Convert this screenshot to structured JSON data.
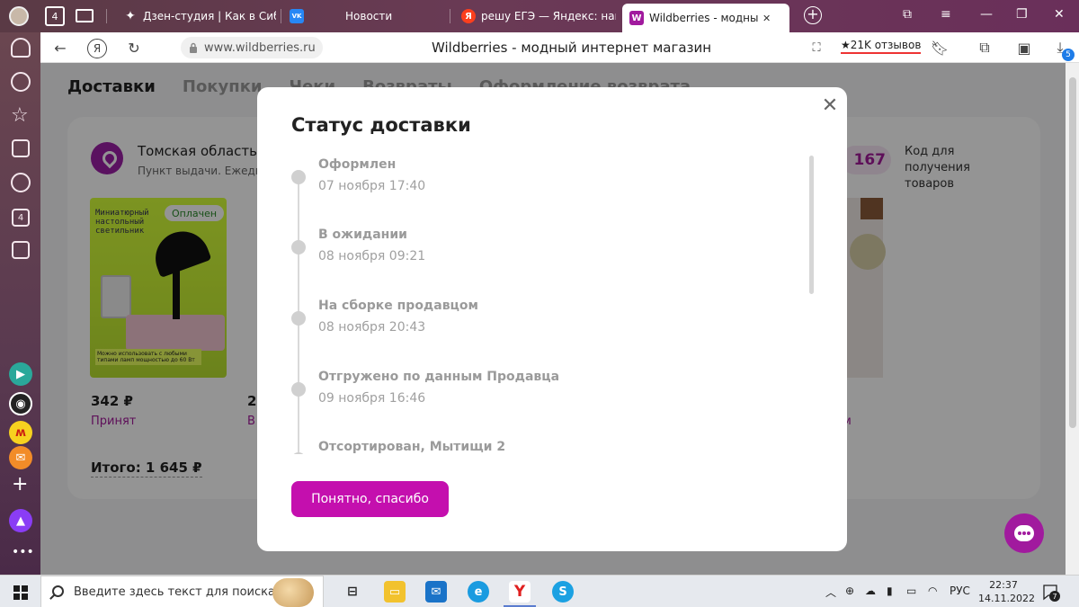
{
  "browser": {
    "tab_count": "4",
    "tabs": [
      {
        "label": "Дзен-студия | Как в Сибир"
      },
      {
        "label": "Новости"
      },
      {
        "label": "решу ЕГЭ — Яндекс: нашл"
      },
      {
        "label": "Wildberries - модный ин"
      }
    ],
    "vk_label": "VK",
    "url": "www.wildberries.ru",
    "page_title": "Wildberries - модный интернет магазин",
    "reviews": "★21K отзывов",
    "downloads_badge": "5",
    "sidebar_badge": "4"
  },
  "page": {
    "nav_tabs": [
      "Доставки",
      "Покупки",
      "Чеки",
      "Возвраты",
      "Оформление возврата"
    ],
    "address_line1": "Томская область, То",
    "address_line2": "Пункт выдачи. Ежедне",
    "pickup_code": "167",
    "code_label": "Код для получения товаров",
    "paid_badge": "Оплачен",
    "product_text": "Миниатюрный настольный светильник",
    "product_foot": "Можно использовать с любыми типами ламп мощностью до 60 Вт",
    "price1": "342 ₽",
    "price2": "2",
    "status1": "Принят",
    "status2": "В",
    "status3": "м",
    "total": "Итого: 1 645 ₽"
  },
  "modal": {
    "title": "Статус доставки",
    "close_glyph": "✕",
    "events": [
      {
        "title": "Оформлен",
        "date": "07 ноября 17:40"
      },
      {
        "title": "В ожидании",
        "date": "08 ноября 09:21"
      },
      {
        "title": "На сборке продавцом",
        "date": "08 ноября 20:43"
      },
      {
        "title": "Отгружено по данным Продавца",
        "date": "09 ноября 16:46"
      },
      {
        "title": "Отсортирован, Мытищи 2",
        "date": ""
      }
    ],
    "ok_button": "Понятно, спасибо"
  },
  "taskbar": {
    "search_placeholder": "Введите здесь текст для поиска",
    "lang": "РУС",
    "time": "22:37",
    "date": "14.11.2022",
    "notif_count": "7"
  },
  "colors": {
    "accent": "#c40fae",
    "brand_purple": "#9b1fa5",
    "status_text": "#a21a9a"
  }
}
